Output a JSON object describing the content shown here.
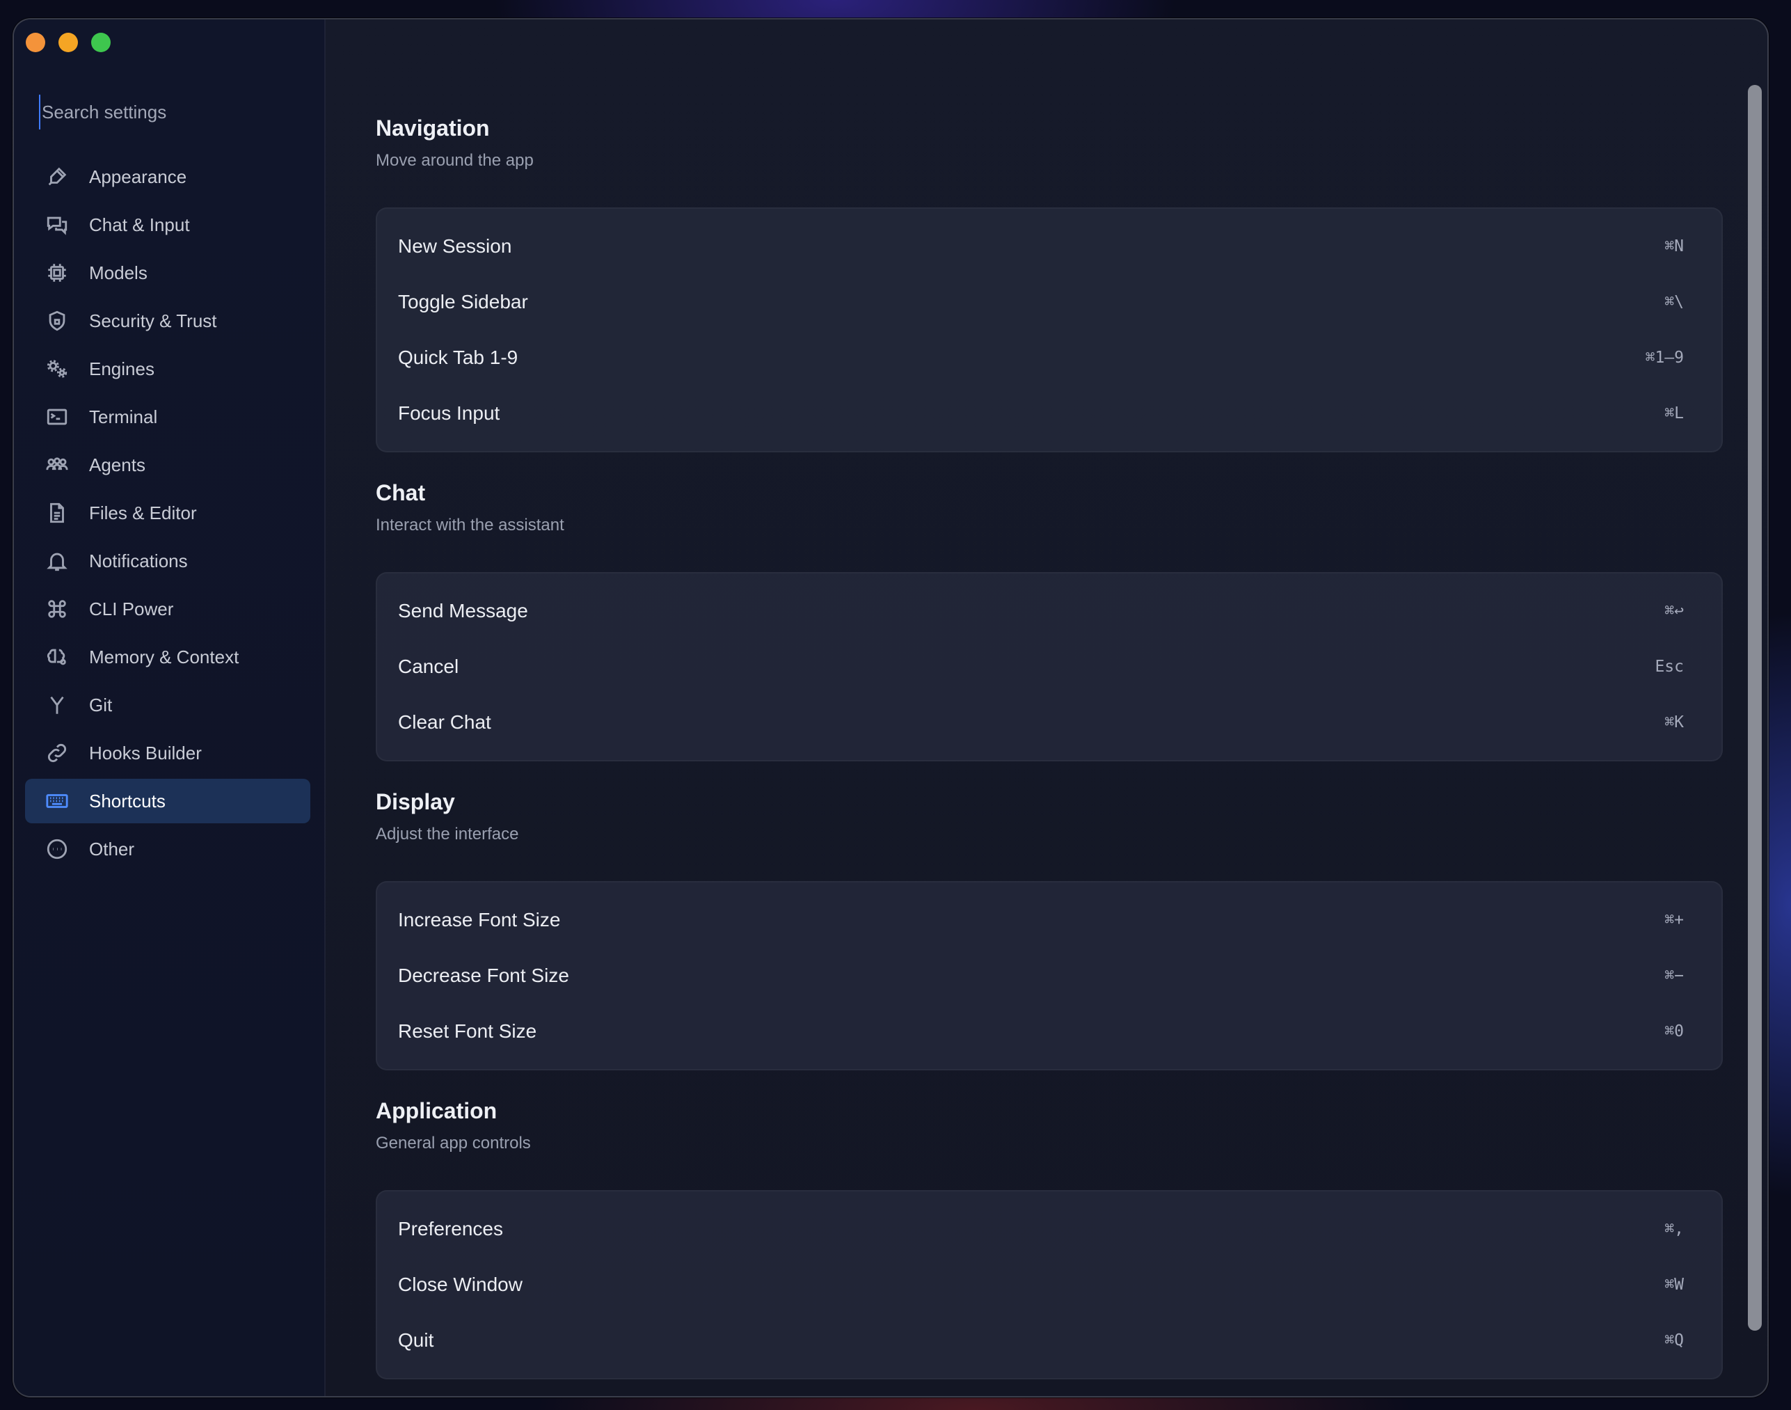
{
  "window": {
    "controls": [
      "close",
      "minimize",
      "maximize"
    ]
  },
  "search": {
    "placeholder": "Search settings"
  },
  "sidebar": {
    "active": "Shortcuts",
    "items": [
      {
        "label": "Appearance",
        "icon": "brush-icon"
      },
      {
        "label": "Chat & Input",
        "icon": "chat-bubbles-icon"
      },
      {
        "label": "Models",
        "icon": "cpu-icon"
      },
      {
        "label": "Security & Trust",
        "icon": "shield-icon"
      },
      {
        "label": "Engines",
        "icon": "gears-icon"
      },
      {
        "label": "Terminal",
        "icon": "terminal-icon"
      },
      {
        "label": "Agents",
        "icon": "users-icon"
      },
      {
        "label": "Files & Editor",
        "icon": "file-icon"
      },
      {
        "label": "Notifications",
        "icon": "bell-icon"
      },
      {
        "label": "CLI Power",
        "icon": "command-icon"
      },
      {
        "label": "Memory & Context",
        "icon": "brain-icon"
      },
      {
        "label": "Git",
        "icon": "git-branch-icon"
      },
      {
        "label": "Hooks Builder",
        "icon": "link-icon"
      },
      {
        "label": "Shortcuts",
        "icon": "keyboard-icon"
      },
      {
        "label": "Other",
        "icon": "more-circle-icon"
      }
    ]
  },
  "sections": [
    {
      "title": "Navigation",
      "subtitle": "Move around the app",
      "rows": [
        {
          "label": "New Session",
          "key": "⌘N"
        },
        {
          "label": "Toggle Sidebar",
          "key": "⌘\\"
        },
        {
          "label": "Quick Tab 1-9",
          "key": "⌘1–9"
        },
        {
          "label": "Focus Input",
          "key": "⌘L"
        }
      ]
    },
    {
      "title": "Chat",
      "subtitle": "Interact with the assistant",
      "rows": [
        {
          "label": "Send Message",
          "key": "⌘↩"
        },
        {
          "label": "Cancel",
          "key": "Esc"
        },
        {
          "label": "Clear Chat",
          "key": "⌘K"
        }
      ]
    },
    {
      "title": "Display",
      "subtitle": "Adjust the interface",
      "rows": [
        {
          "label": "Increase Font Size",
          "key": "⌘+"
        },
        {
          "label": "Decrease Font Size",
          "key": "⌘−"
        },
        {
          "label": "Reset Font Size",
          "key": "⌘0"
        }
      ]
    },
    {
      "title": "Application",
      "subtitle": "General app controls",
      "rows": [
        {
          "label": "Preferences",
          "key": "⌘,"
        },
        {
          "label": "Close Window",
          "key": "⌘W"
        },
        {
          "label": "Quit",
          "key": "⌘Q"
        }
      ]
    }
  ]
}
